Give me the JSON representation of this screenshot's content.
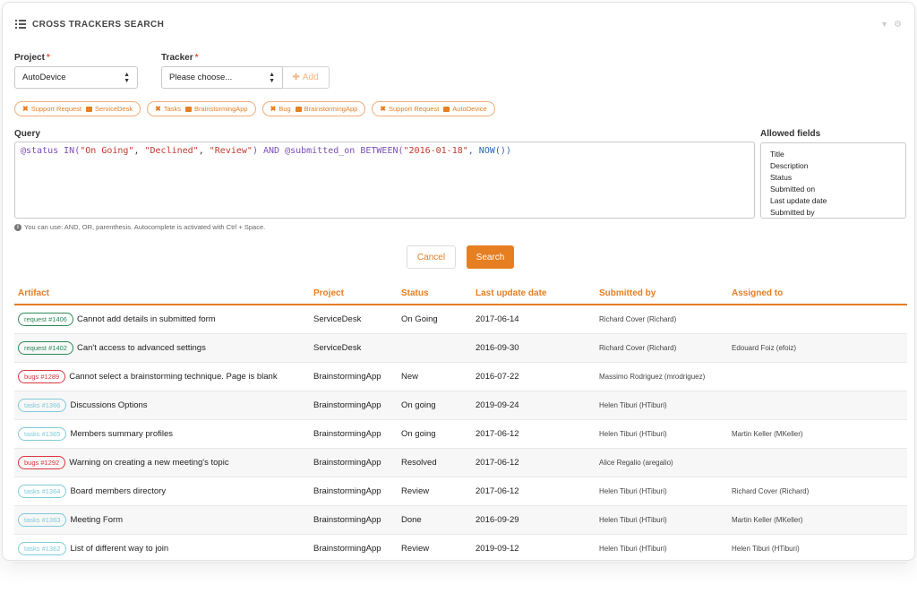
{
  "header": {
    "title": "CROSS TRACKERS SEARCH"
  },
  "project": {
    "label": "Project",
    "required_mark": "*",
    "value": "AutoDevice"
  },
  "tracker": {
    "label": "Tracker",
    "required_mark": "*",
    "value": "Please choose...",
    "add_label": "Add"
  },
  "chips": [
    {
      "name": "Support Request",
      "project": "ServiceDesk"
    },
    {
      "name": "Tasks",
      "project": "BrainstormingApp"
    },
    {
      "name": "Bug",
      "project": "BrainstormingApp"
    },
    {
      "name": "Support Request",
      "project": "AutoDevice"
    }
  ],
  "query": {
    "label": "Query",
    "tokens": [
      {
        "t": "@status IN(",
        "c": "kw"
      },
      {
        "t": "\"On Going\"",
        "c": "str"
      },
      {
        "t": ", ",
        "c": "plain"
      },
      {
        "t": "\"Declined\"",
        "c": "str"
      },
      {
        "t": ", ",
        "c": "plain"
      },
      {
        "t": "\"Review\"",
        "c": "str"
      },
      {
        "t": ") AND @submitted_on BETWEEN(",
        "c": "kw"
      },
      {
        "t": "\"2016-01-18\"",
        "c": "str"
      },
      {
        "t": ", NOW())",
        "c": "fn"
      }
    ],
    "hint": "You can use: AND, OR, parenthesis. Autocomplete is activated with Ctrl + Space."
  },
  "allowed_fields": {
    "label": "Allowed fields",
    "items": [
      "Title",
      "Description",
      "Status",
      "Submitted on",
      "Last update date",
      "Submitted by"
    ]
  },
  "buttons": {
    "cancel": "Cancel",
    "search": "Search"
  },
  "table": {
    "columns": [
      "Artifact",
      "Project",
      "Status",
      "Last update date",
      "Submitted by",
      "Assigned to"
    ],
    "rows": [
      {
        "badge": "request #1406",
        "badge_color": "#2e8b57",
        "title": "Cannot add details in submitted form",
        "project": "ServiceDesk",
        "status": "On Going",
        "date": "2017-06-14",
        "submitted_by": "Richard Cover (Richard)",
        "assigned_to": ""
      },
      {
        "badge": "request #1402",
        "badge_color": "#2e8b57",
        "title": "Can't access to advanced settings",
        "project": "ServiceDesk",
        "status": "",
        "date": "2016-09-30",
        "submitted_by": "Richard Cover (Richard)",
        "assigned_to": "Edouard Foiz (efoiz)"
      },
      {
        "badge": "bugs #1289",
        "badge_color": "#d9363e",
        "title": "Cannot select a brainstorming technique. Page is blank",
        "project": "BrainstormingApp",
        "status": "New",
        "date": "2016-07-22",
        "submitted_by": "Massimo Rodriguez (mrodriguez)",
        "assigned_to": ""
      },
      {
        "badge": "tasks #1366",
        "badge_color": "#7ecbd9",
        "title": "Discussions Options",
        "project": "BrainstormingApp",
        "status": "On going",
        "date": "2019-09-24",
        "submitted_by": "Helen Tiburi (HTiburi)",
        "assigned_to": ""
      },
      {
        "badge": "tasks #1365",
        "badge_color": "#7ecbd9",
        "title": "Members summary profiles",
        "project": "BrainstormingApp",
        "status": "On going",
        "date": "2017-06-12",
        "submitted_by": "Helen Tiburi (HTiburi)",
        "assigned_to": "Martin Keller (MKeller)"
      },
      {
        "badge": "bugs #1292",
        "badge_color": "#d9363e",
        "title": "Warning on creating a new meeting's topic",
        "project": "BrainstormingApp",
        "status": "Resolved",
        "date": "2017-06-12",
        "submitted_by": "Alice Regalio (aregalio)",
        "assigned_to": ""
      },
      {
        "badge": "tasks #1364",
        "badge_color": "#7ecbd9",
        "title": "Board members directory",
        "project": "BrainstormingApp",
        "status": "Review",
        "date": "2017-06-12",
        "submitted_by": "Helen Tiburi (HTiburi)",
        "assigned_to": "Richard Cover (Richard)"
      },
      {
        "badge": "tasks #1363",
        "badge_color": "#7ecbd9",
        "title": "Meeting Form",
        "project": "BrainstormingApp",
        "status": "Done",
        "date": "2016-09-29",
        "submitted_by": "Helen Tiburi (HTiburi)",
        "assigned_to": "Martin Keller (MKeller)"
      },
      {
        "badge": "tasks #1362",
        "badge_color": "#7ecbd9",
        "title": "List of different way to join",
        "project": "BrainstormingApp",
        "status": "Review",
        "date": "2019-09-12",
        "submitted_by": "Helen Tiburi (HTiburi)",
        "assigned_to": "Helen Tiburi (HTiburi)"
      }
    ]
  },
  "colors": {
    "accent": "#e67e22"
  }
}
